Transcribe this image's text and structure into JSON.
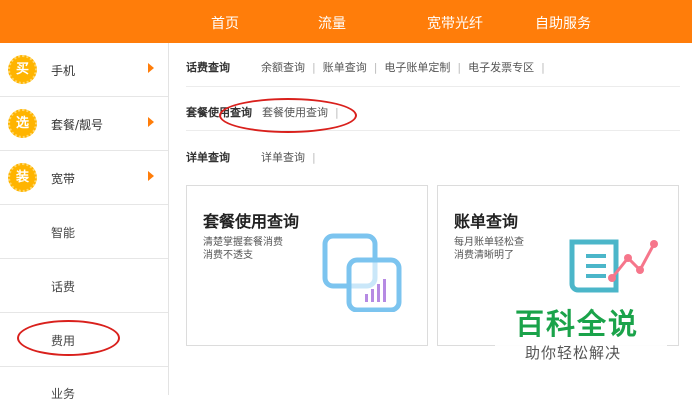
{
  "topnav": {
    "items": [
      "首页",
      "流量",
      "宽带光纤",
      "自助服务"
    ]
  },
  "sidebar": {
    "categories": [
      {
        "badge": "买",
        "label": "手机"
      },
      {
        "badge": "选",
        "label": "套餐/靓号"
      },
      {
        "badge": "装",
        "label": "宽带"
      }
    ],
    "sub_items": [
      "智能",
      "话费",
      "费用",
      "业务"
    ]
  },
  "main": {
    "rows": [
      {
        "label": "话费查询",
        "links": [
          "余额查询",
          "账单查询",
          "电子账单定制",
          "电子发票专区"
        ]
      },
      {
        "label": "套餐使用查询",
        "links": [
          "套餐使用查询"
        ]
      },
      {
        "label": "详单查询",
        "links": [
          "详单查询"
        ]
      }
    ],
    "cards": [
      {
        "title": "套餐使用查询",
        "desc": "清楚掌握套餐消费\n消费不透支"
      },
      {
        "title": "账单查询",
        "desc": "每月账单轻松查\n消费清晰明了"
      }
    ]
  },
  "watermark": {
    "title": "百科全说",
    "subtitle": "助你轻松解决"
  },
  "colors": {
    "accent": "#ff7d0a",
    "badge": "#ffb400",
    "annotation": "#d9201c",
    "watermark": "#1aa34a"
  }
}
